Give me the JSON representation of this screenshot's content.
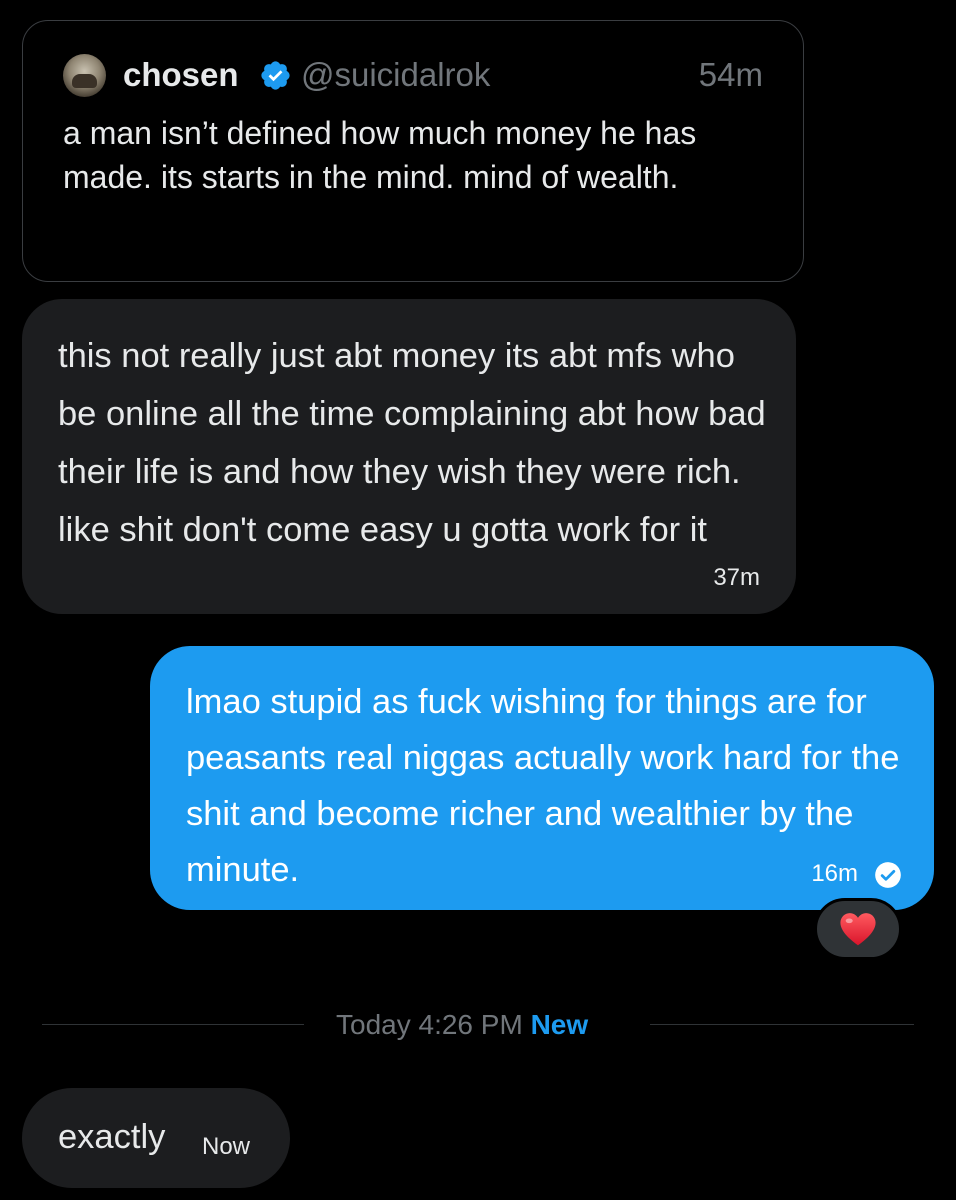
{
  "quoted_post": {
    "author_name": "chosen",
    "handle": "@suicidalrok",
    "time": "54m",
    "text": "a man isn’t defined how much money he has made. its starts in the mind. mind of wealth.",
    "verified_icon": "verified-badge-icon",
    "avatar_icon": "avatar"
  },
  "messages": [
    {
      "direction": "received",
      "text": "this not really just abt money its abt mfs who be online all the time complaining abt how bad their life is and how they wish they were rich. like shit don't come easy u gotta work for it",
      "time": "37m"
    },
    {
      "direction": "sent",
      "text": "lmao stupid as fuck wishing for things are for peasants real niggas actually work hard for the shit and become richer and wealthier by the minute.",
      "time": "16m",
      "status_icon": "seen-check-icon",
      "reaction": "❤️"
    },
    {
      "direction": "received",
      "text": "exactly",
      "time": "Now"
    }
  ],
  "divider": {
    "label": "Today 4:26 PM",
    "new_label": "New"
  },
  "colors": {
    "background": "#000000",
    "received_bubble": "#1c1d1f",
    "sent_bubble": "#1d9bf0",
    "accent": "#1d9bf0",
    "muted_text": "#71767b",
    "primary_text": "#e7e9ea"
  }
}
